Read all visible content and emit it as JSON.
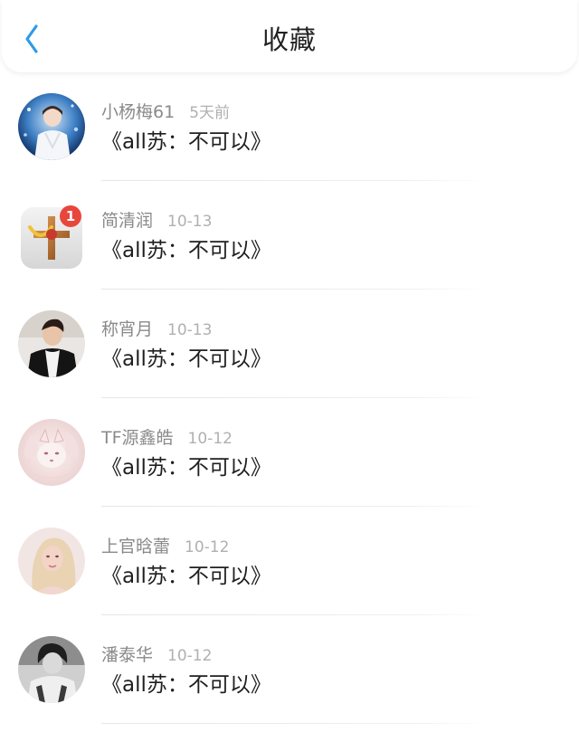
{
  "header": {
    "title": "收藏",
    "back_icon": "chevron-left-icon",
    "accent": "#2f9be8"
  },
  "favorites": [
    {
      "user": "小杨梅61",
      "time": "5天前",
      "content": "《all苏：不可以》",
      "avatar": "avatar-photo-white-outfit"
    },
    {
      "user": "简清润",
      "time": "10-13",
      "content": "《all苏：不可以》",
      "avatar": "avatar-game-icon",
      "badge": "1"
    },
    {
      "user": "称宵月",
      "time": "10-13",
      "content": "《all苏：不可以》",
      "avatar": "avatar-photo-black-jacket"
    },
    {
      "user": "TF源鑫皓",
      "time": "10-12",
      "content": "《all苏：不可以》",
      "avatar": "avatar-fox-illustration"
    },
    {
      "user": "上官晗蕾",
      "time": "10-12",
      "content": "《all苏：不可以》",
      "avatar": "avatar-photo-blonde"
    },
    {
      "user": "潘泰华",
      "time": "10-12",
      "content": "《all苏：不可以》",
      "avatar": "avatar-photo-grayscale"
    }
  ]
}
